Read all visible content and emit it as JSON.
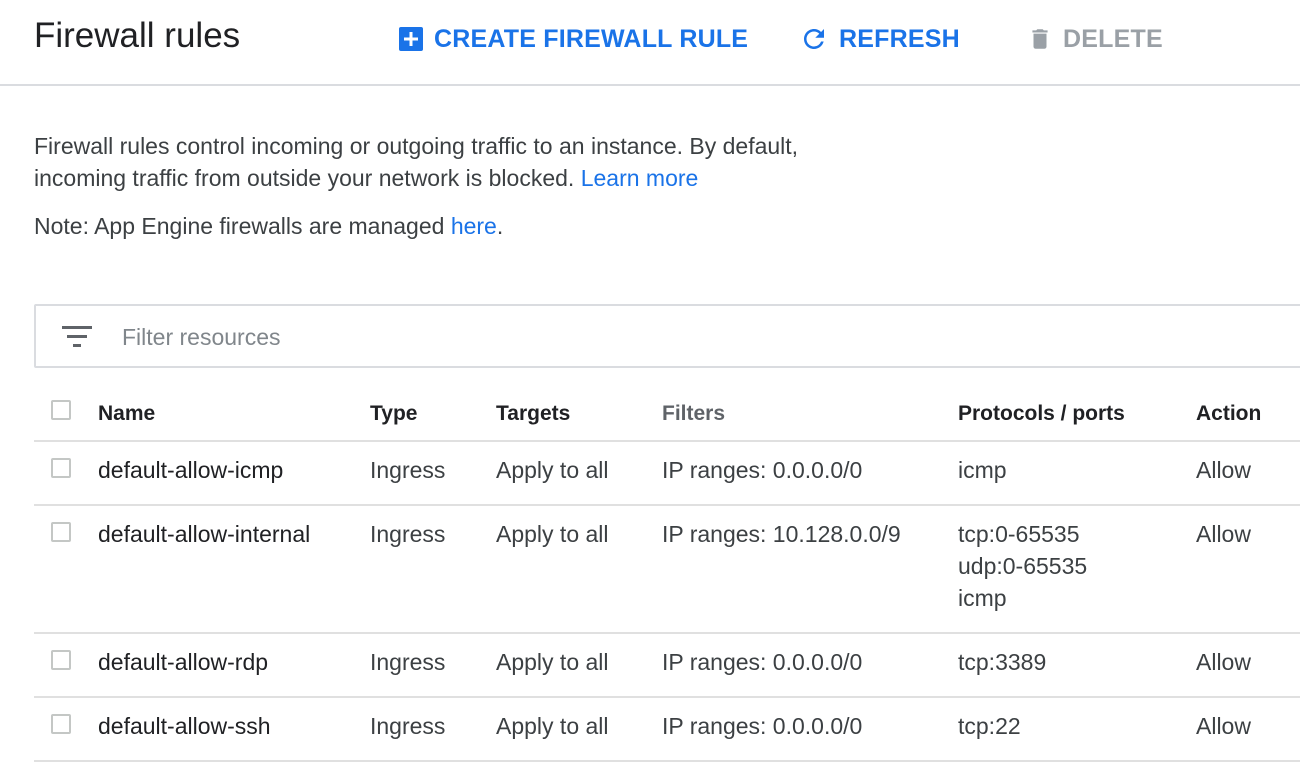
{
  "header": {
    "title": "Firewall rules",
    "create_label": "CREATE FIREWALL RULE",
    "refresh_label": "REFRESH",
    "delete_label": "DELETE",
    "create_icon": "add-box-icon",
    "refresh_icon": "refresh-icon",
    "delete_icon": "trash-icon"
  },
  "intro": {
    "text": "Firewall rules control incoming or outgoing traffic to an instance. By default, incoming traffic from outside your network is blocked.",
    "learn_more": "Learn more"
  },
  "note": {
    "prefix": "Note: App Engine firewalls are managed",
    "link": "here",
    "suffix": "."
  },
  "filter": {
    "placeholder": "Filter resources",
    "icon": "filter-list-icon"
  },
  "table": {
    "columns": [
      "Name",
      "Type",
      "Targets",
      "Filters",
      "Protocols / ports",
      "Action"
    ],
    "rows": [
      {
        "name": "default-allow-icmp",
        "type": "Ingress",
        "targets": "Apply to all",
        "filters": "IP ranges: 0.0.0.0/0",
        "ports": [
          "icmp"
        ],
        "action": "Allow"
      },
      {
        "name": "default-allow-internal",
        "type": "Ingress",
        "targets": "Apply to all",
        "filters": "IP ranges: 10.128.0.0/9",
        "ports": [
          "tcp:0-65535",
          "udp:0-65535",
          "icmp"
        ],
        "action": "Allow"
      },
      {
        "name": "default-allow-rdp",
        "type": "Ingress",
        "targets": "Apply to all",
        "filters": "IP ranges: 0.0.0.0/0",
        "ports": [
          "tcp:3389"
        ],
        "action": "Allow"
      },
      {
        "name": "default-allow-ssh",
        "type": "Ingress",
        "targets": "Apply to all",
        "filters": "IP ranges: 0.0.0.0/0",
        "ports": [
          "tcp:22"
        ],
        "action": "Allow"
      }
    ]
  },
  "colors": {
    "accent": "#1a73e8",
    "disabled": "#9aa0a6",
    "border": "#dadce0"
  }
}
